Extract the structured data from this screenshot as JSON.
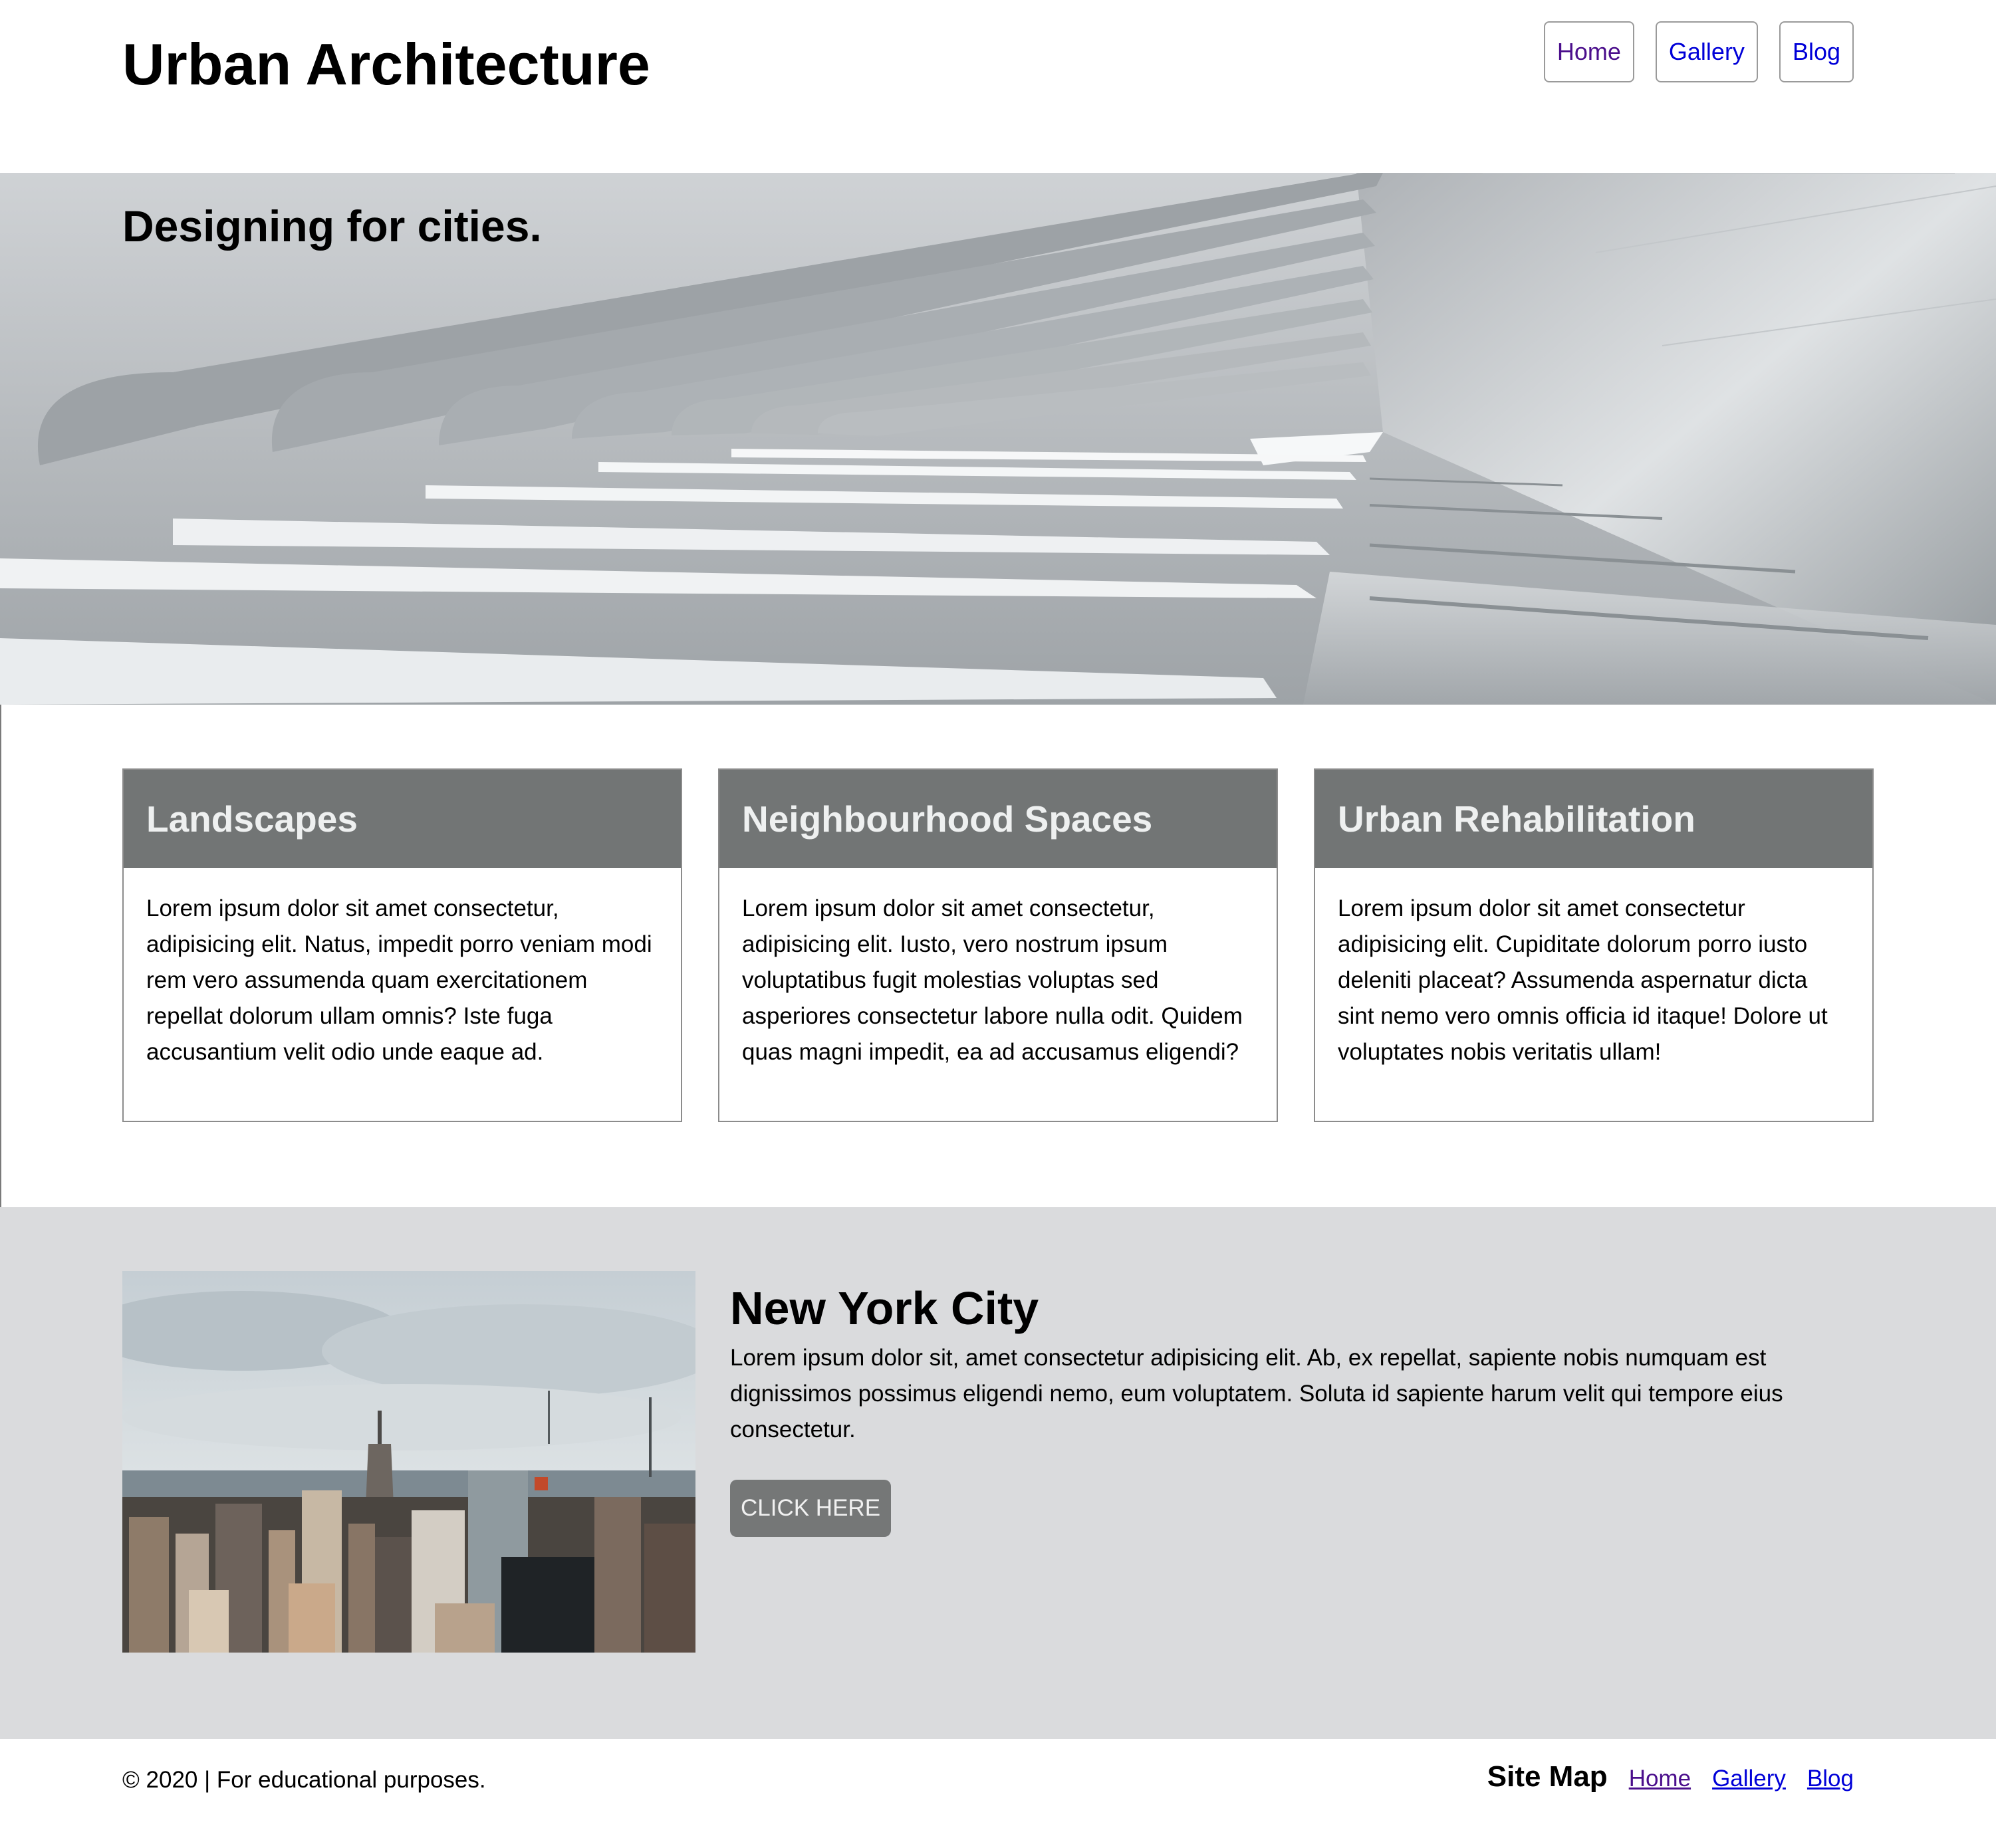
{
  "header": {
    "site_title": "Urban Architecture",
    "nav": [
      {
        "label": "Home"
      },
      {
        "label": "Gallery"
      },
      {
        "label": "Blog"
      }
    ]
  },
  "hero": {
    "tagline": "Designing for cities."
  },
  "cards": [
    {
      "title": "Landscapes",
      "text": "Lorem ipsum dolor sit amet consectetur, adipisicing elit. Natus, impedit porro veniam modi rem vero assumenda quam exercitationem repellat dolorum ullam omnis? Iste fuga accusantium velit odio unde eaque ad."
    },
    {
      "title": "Neighbourhood Spaces",
      "text": "Lorem ipsum dolor sit amet consectetur, adipisicing elit. Iusto, vero nostrum ipsum voluptatibus fugit molestias voluptas sed asperiores consectetur labore nulla odit. Quidem quas magni impedit, ea ad accusamus eligendi?"
    },
    {
      "title": "Urban Rehabilitation",
      "text": "Lorem ipsum dolor sit amet consectetur adipisicing elit. Cupiditate dolorum porro iusto deleniti placeat? Assumenda aspernatur dicta sint nemo vero omnis officia id itaque! Dolore ut voluptates nobis veritatis ullam!"
    }
  ],
  "feature": {
    "title": "New York City",
    "text": "Lorem ipsum dolor sit, amet consectetur adipisicing elit. Ab, ex repellat, sapiente nobis numquam est dignissimos possimus eligendi nemo, eum voluptatem. Soluta id sapiente harum velit qui tempore eius consectetur.",
    "button_label": "CLICK HERE"
  },
  "footer": {
    "copyright": "© 2020 | For educational purposes.",
    "sitemap_title": "Site Map",
    "links": [
      {
        "label": "Home"
      },
      {
        "label": "Gallery"
      },
      {
        "label": "Blog"
      }
    ]
  },
  "colors": {
    "card_header": "#727575",
    "feature_background": "#dadbdd",
    "button_background": "#757777",
    "link": "#0000d8",
    "visited_link": "#4b0f8c"
  }
}
